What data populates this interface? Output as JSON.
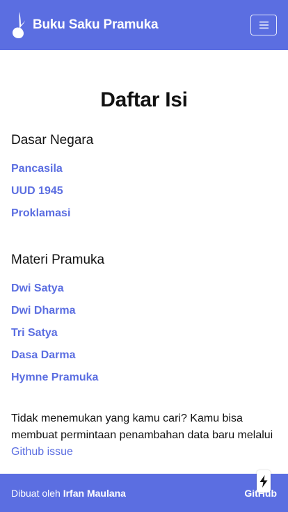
{
  "header": {
    "title": "Buku Saku Pramuka",
    "logo_icon": "tunas-kelapa-logo-icon",
    "menu_icon": "hamburger-menu-icon"
  },
  "main": {
    "page_title": "Daftar Isi",
    "sections": [
      {
        "title": "Dasar Negara",
        "links": [
          "Pancasila",
          "UUD 1945",
          "Proklamasi"
        ]
      },
      {
        "title": "Materi Pramuka",
        "links": [
          "Dwi Satya",
          "Dwi Dharma",
          "Tri Satya",
          "Dasa Darma",
          "Hymne Pramuka"
        ]
      }
    ],
    "note_text": "Tidak menemukan yang kamu cari? Kamu bisa membuat permintaan penambahan data baru melalui ",
    "note_link": "Github issue"
  },
  "footer": {
    "made_by_prefix": "Dibuat oleh ",
    "author": "Irfan Maulana",
    "github_link": "GitHub"
  },
  "floating": {
    "icon": "lightning-bolt-icon"
  },
  "colors": {
    "brand": "#5b6ee1",
    "text": "#111111",
    "background": "#ffffff"
  }
}
